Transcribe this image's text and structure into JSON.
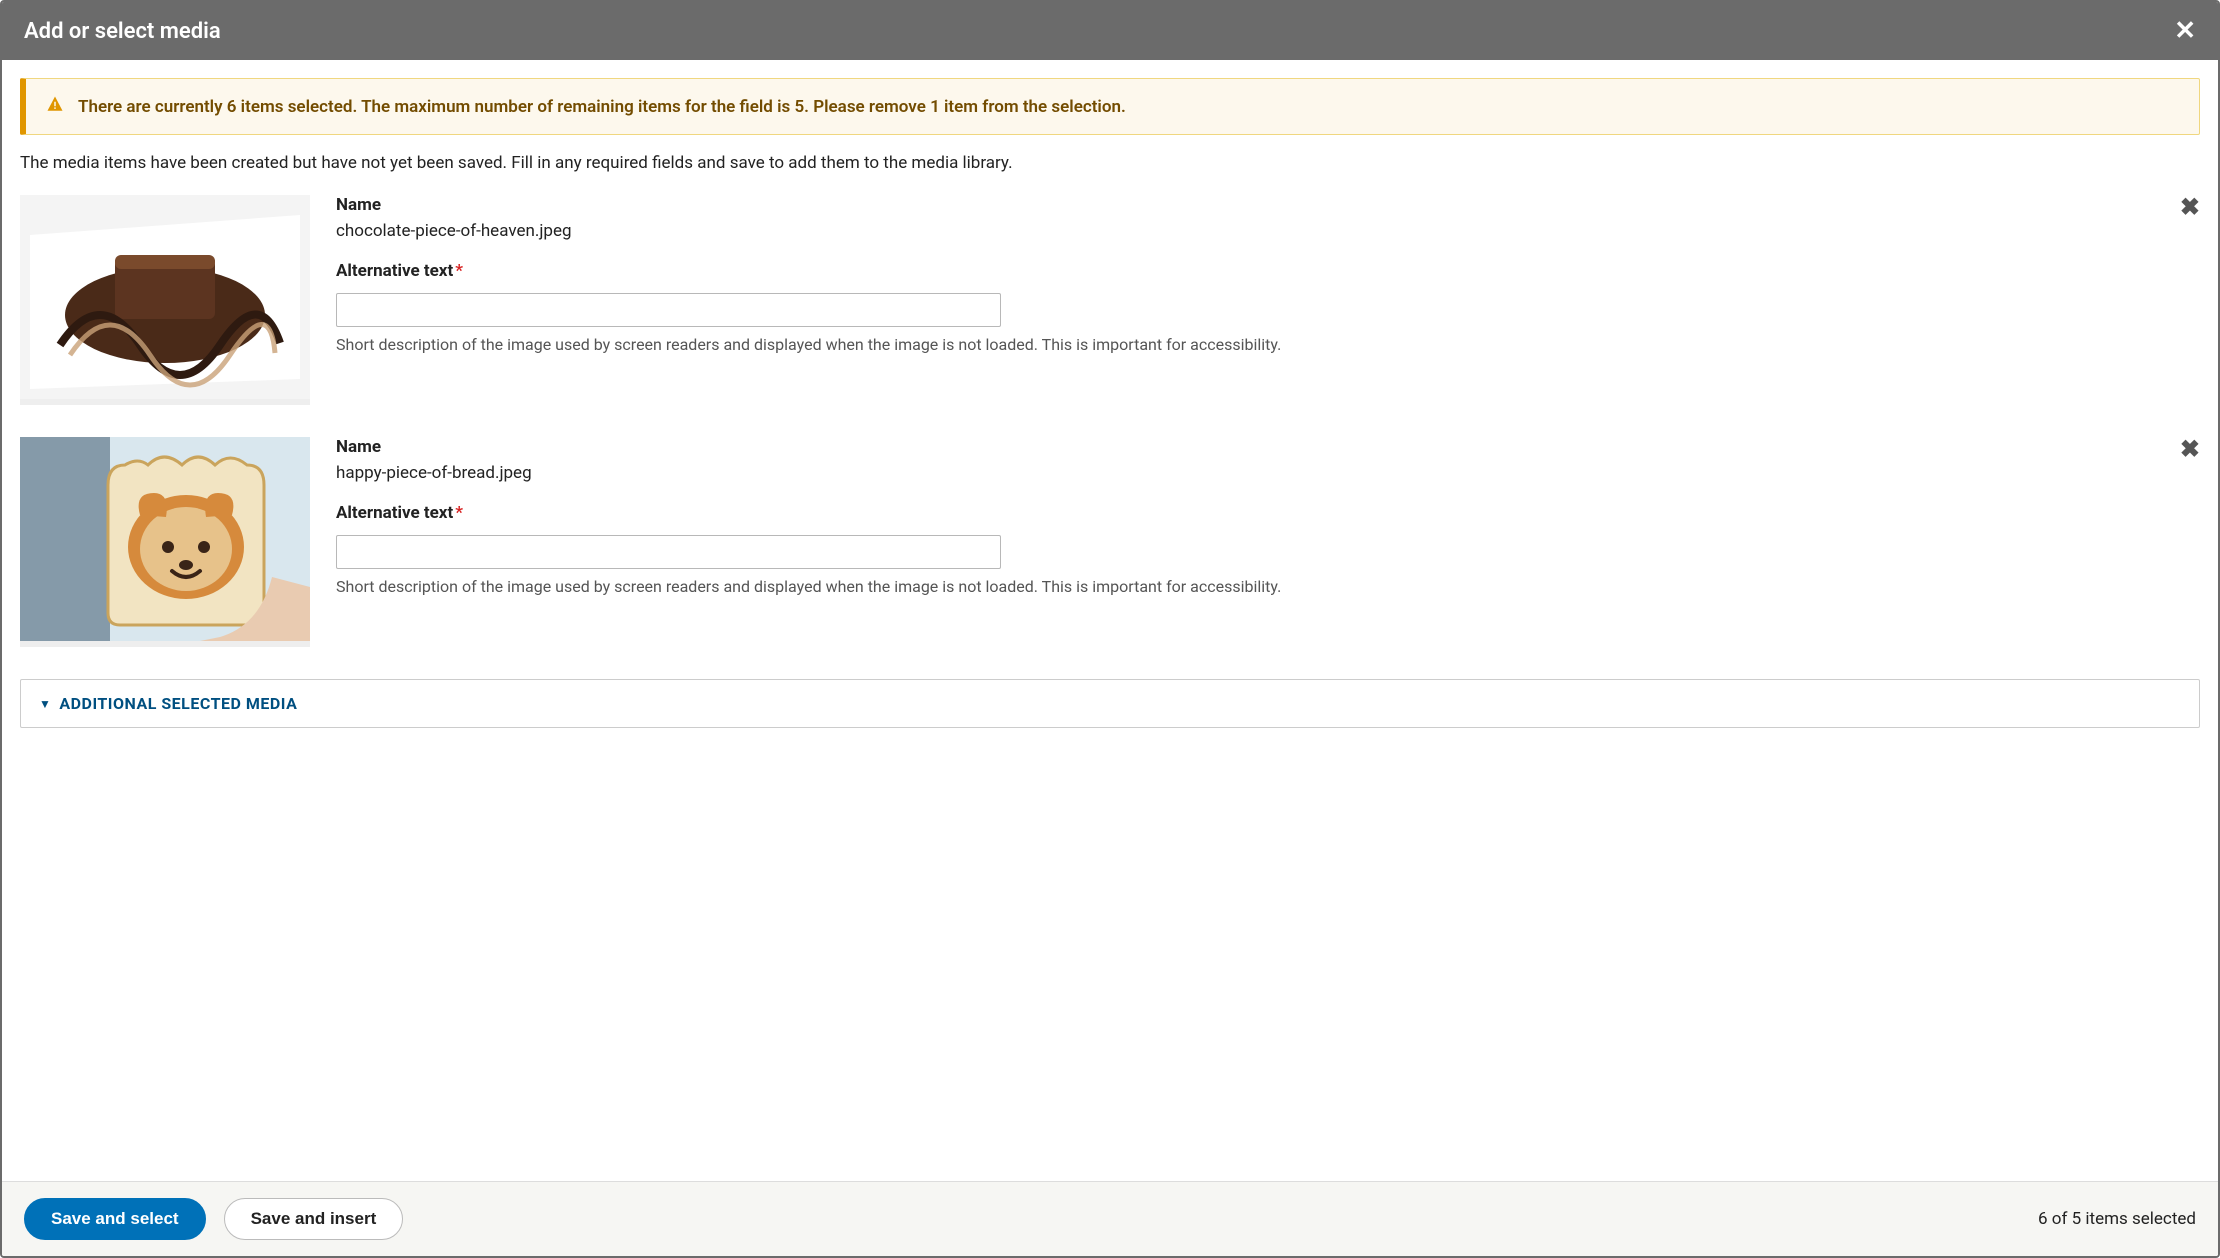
{
  "dialog": {
    "title": "Add or select media"
  },
  "warning": {
    "message": "There are currently 6 items selected. The maximum number of remaining items for the field is 5. Please remove 1 item from the selection."
  },
  "intro": "The media items have been created but have not yet been saved. Fill in any required fields and save to add them to the media library.",
  "labels": {
    "name": "Name",
    "alt_text": "Alternative text",
    "alt_help": "Short description of the image used by screen readers and displayed when the image is not loaded. This is important for accessibility."
  },
  "items": [
    {
      "filename": "chocolate-piece-of-heaven.jpeg",
      "alt_value": ""
    },
    {
      "filename": "happy-piece-of-bread.jpeg",
      "alt_value": ""
    }
  ],
  "accordion": {
    "title": "Additional selected media"
  },
  "footer": {
    "save_select": "Save and select",
    "save_insert": "Save and insert",
    "status": "6 of 5 items selected"
  }
}
